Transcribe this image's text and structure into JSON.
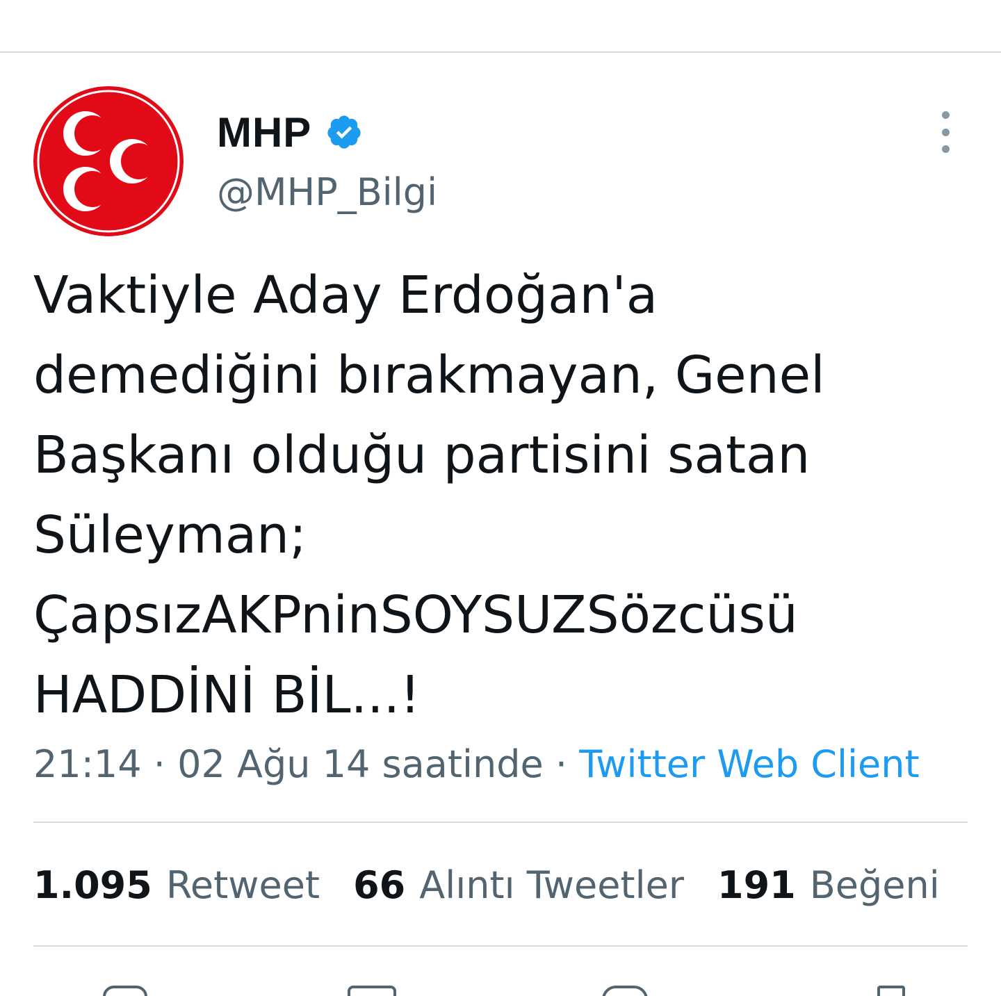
{
  "tweet": {
    "author": {
      "display_name": "MHP",
      "handle": "@MHP_Bilgi",
      "verified": true,
      "avatar_icon": "mhp-crescents-logo"
    },
    "text_lines": [
      "Vaktiyle Aday Erdoğan'a",
      "demediğini bırakmayan, Genel",
      "Başkanı olduğu partisini satan",
      "Süleyman;",
      "ÇapsızAKPninSOYSUZSözcüsü",
      "HADDİNİ BİL...!"
    ],
    "time": "21:14",
    "date": "02 Ağu 14 saatinde",
    "separator": "·",
    "source": "Twitter Web Client"
  },
  "stats": {
    "retweets": {
      "count": "1.095",
      "label": "Retweet"
    },
    "quotes": {
      "count": "66",
      "label": "Alıntı Tweetler"
    },
    "likes": {
      "count": "191",
      "label": "Beğeni"
    }
  },
  "icons": [
    "more-options-icon",
    "verified-badge-icon",
    "reply-icon",
    "retweet-icon",
    "like-icon",
    "share-icon"
  ],
  "colors": {
    "text": "#0f1419",
    "secondary": "#536471",
    "link": "#1d9bf0",
    "verified": "#1d9bf0",
    "logo_red": "#e30a17",
    "divider": "#cfd9de"
  }
}
